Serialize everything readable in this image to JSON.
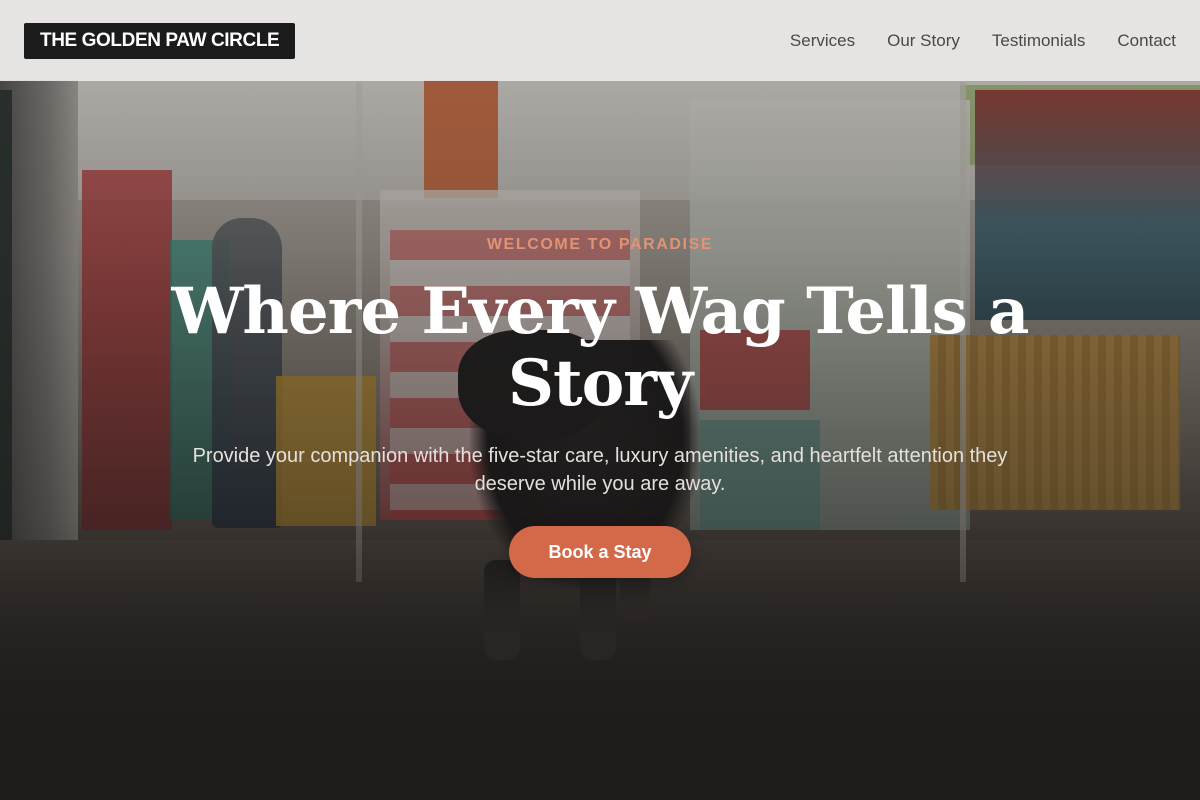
{
  "brand": {
    "logo_text": "THE GOLDEN PAW CIRCLE"
  },
  "nav": {
    "links": [
      {
        "label": "Services"
      },
      {
        "label": "Our Story"
      },
      {
        "label": "Testimonials"
      },
      {
        "label": "Contact"
      }
    ]
  },
  "hero": {
    "eyebrow": "WELCOME TO PARADISE",
    "headline": "Where Every Wag Tells a Story",
    "subtext": "Provide your companion with the five-star care, luxury amenities, and heartfelt attention they deserve while you are away.",
    "cta_label": "Book a Stay",
    "background_description_icon": "pet-store-photo"
  },
  "colors": {
    "accent": "#d4694a",
    "eyebrow": "#e39274",
    "logo_bg": "#1c1b1b",
    "navbar_bg": "#eceae8"
  }
}
